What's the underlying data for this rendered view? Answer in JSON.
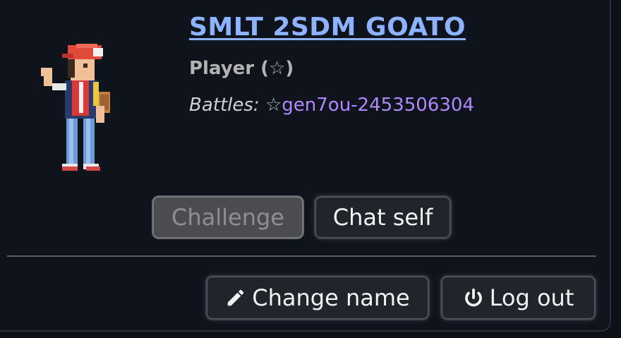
{
  "user": {
    "name": "SMLT 2SDM GOATO",
    "group": "Player (☆)",
    "battles_label": "Battles:",
    "battle_star": "☆",
    "battle_room": "gen7ou-2453506304"
  },
  "buttons": {
    "challenge": "Challenge",
    "chat_self": "Chat self",
    "change_name": "Change name",
    "log_out": "Log out"
  },
  "icons": {
    "change_name": "pencil-icon",
    "log_out": "power-icon"
  },
  "colors": {
    "background": "#0f141c",
    "name_link": "#8db3ff",
    "battle_link": "#b188ff",
    "button_bg": "#20242b",
    "disabled_button_bg": "#4a4c50"
  }
}
